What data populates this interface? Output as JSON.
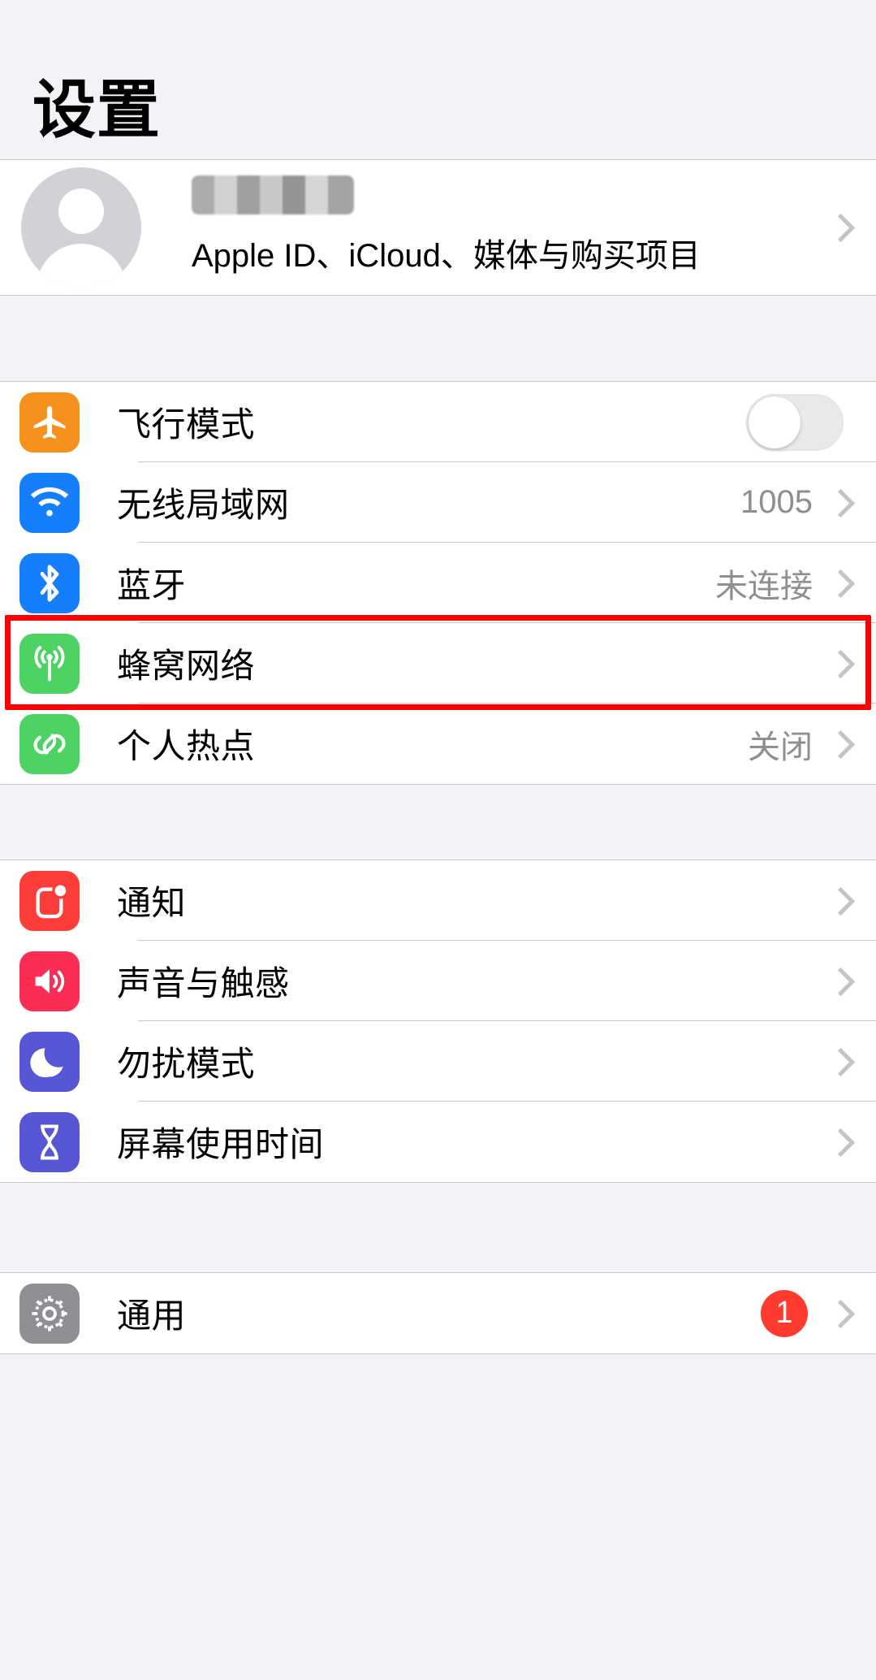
{
  "header": {
    "title": "设置"
  },
  "account": {
    "name_redacted": true,
    "subtitle": "Apple ID、iCloud、媒体与购买项目",
    "avatar_icon": "person-placeholder-icon",
    "chevron": "chevron-right-icon"
  },
  "groups": [
    {
      "id": "connectivity",
      "rows": [
        {
          "id": "airplane-mode",
          "label": "飞行模式",
          "icon": "airplane-icon",
          "icon_color": "#f5921e",
          "control": "toggle",
          "toggle_on": false,
          "value": ""
        },
        {
          "id": "wifi",
          "label": "无线局域网",
          "icon": "wifi-icon",
          "icon_color": "#147efb",
          "control": "chevron",
          "value": "1005"
        },
        {
          "id": "bluetooth",
          "label": "蓝牙",
          "icon": "bluetooth-icon",
          "icon_color": "#147efb",
          "control": "chevron",
          "value": "未连接"
        },
        {
          "id": "cellular",
          "label": "蜂窝网络",
          "icon": "cellular-antenna-icon",
          "icon_color": "#4cd364",
          "control": "chevron",
          "value": "",
          "highlighted": true
        },
        {
          "id": "personal-hotspot",
          "label": "个人热点",
          "icon": "hotspot-link-icon",
          "icon_color": "#4cd364",
          "control": "chevron",
          "value": "关闭"
        }
      ]
    },
    {
      "id": "alerts",
      "rows": [
        {
          "id": "notifications",
          "label": "通知",
          "icon": "notifications-icon",
          "icon_color": "#fc3d39",
          "control": "chevron",
          "value": ""
        },
        {
          "id": "sounds-haptics",
          "label": "声音与触感",
          "icon": "speaker-icon",
          "icon_color": "#fc2d55",
          "control": "chevron",
          "value": ""
        },
        {
          "id": "do-not-disturb",
          "label": "勿扰模式",
          "icon": "moon-icon",
          "icon_color": "#5756d5",
          "control": "chevron",
          "value": ""
        },
        {
          "id": "screen-time",
          "label": "屏幕使用时间",
          "icon": "hourglass-icon",
          "icon_color": "#5756d5",
          "control": "chevron",
          "value": ""
        }
      ]
    },
    {
      "id": "system",
      "rows": [
        {
          "id": "general",
          "label": "通用",
          "icon": "gear-icon",
          "icon_color": "#8e8e93",
          "control": "chevron",
          "value": "",
          "badge": "1"
        }
      ]
    }
  ],
  "annotation": {
    "highlight_color": "#ff0000",
    "target_row": "cellular"
  }
}
